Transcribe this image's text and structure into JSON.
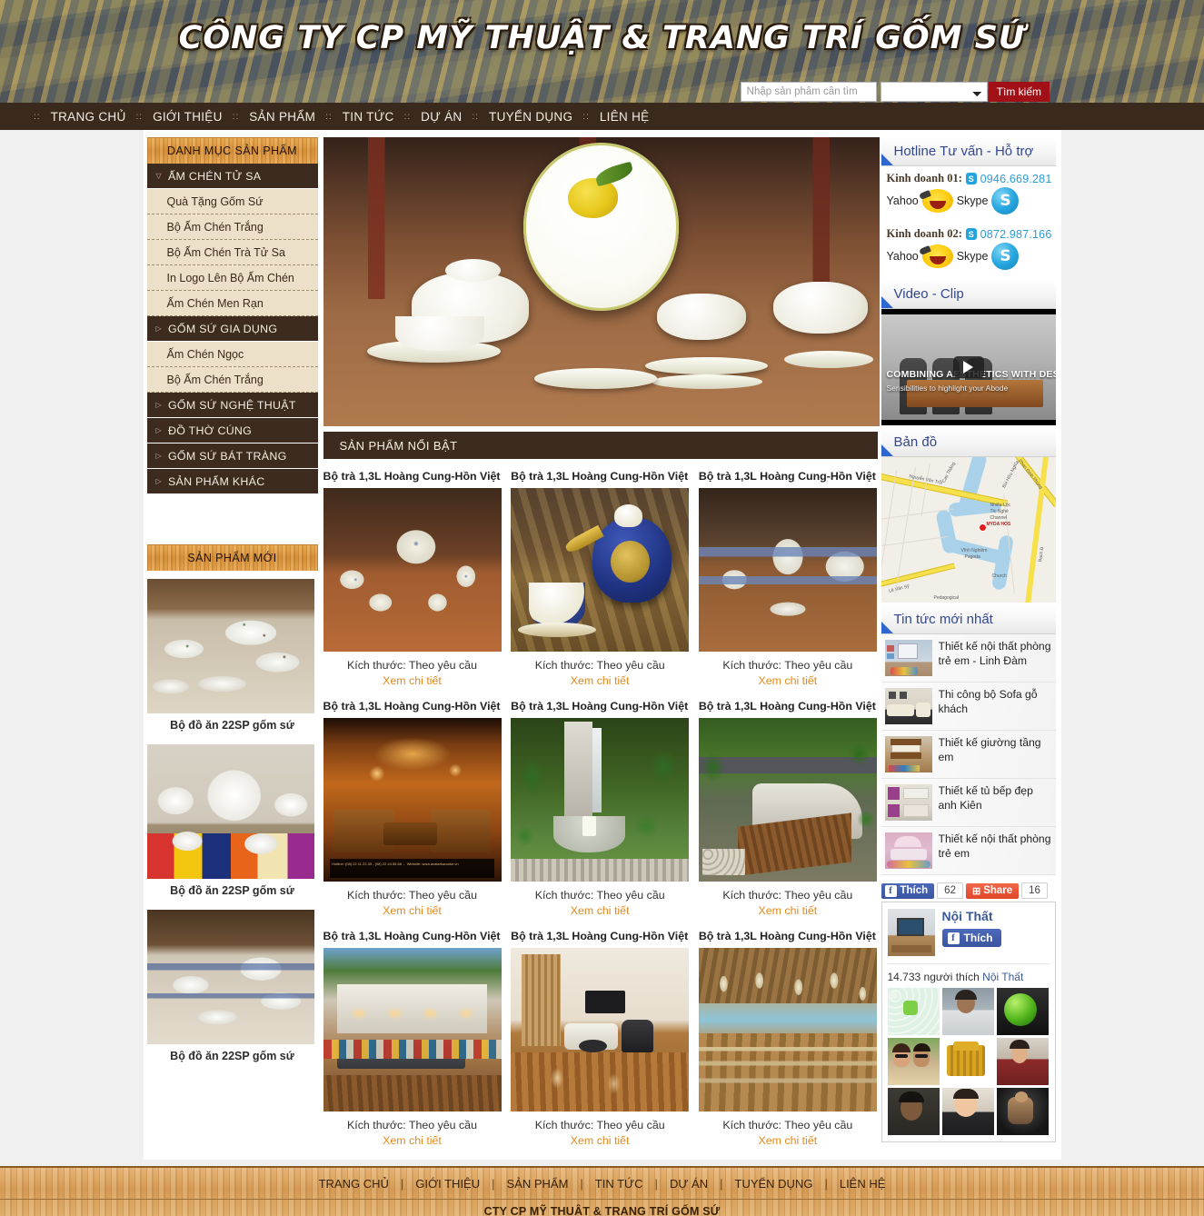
{
  "header": {
    "title": "CÔNG TY CP MỸ THUẬT & TRANG TRÍ GỐM SỨ",
    "search": {
      "placeholder": "Nhập sản phẩm cần tìm",
      "value": "",
      "category_value": "",
      "button_label": "Tìm kiếm"
    }
  },
  "nav": {
    "separator": "::",
    "items": [
      {
        "label": "Trang chủ"
      },
      {
        "label": "Giới thiệu"
      },
      {
        "label": "Sản phẩm"
      },
      {
        "label": "Tin tức"
      },
      {
        "label": "Dự án"
      },
      {
        "label": "Tuyển dụng"
      },
      {
        "label": "Liên hệ"
      }
    ]
  },
  "sidebar_left": {
    "category_panel_title": "DANH MỤC SẢN PHẨM",
    "categories": [
      {
        "label": "ẤM CHÉN TỬ SA",
        "type": "top",
        "expanded": true
      },
      {
        "label": "Quà Tặng Gốm Sứ",
        "type": "sub"
      },
      {
        "label": "Bộ Ấm Chén Trắng",
        "type": "sub"
      },
      {
        "label": "Bộ Ấm Chén Trà Tử Sa",
        "type": "sub"
      },
      {
        "label": "In Logo Lên Bộ Ấm Chén",
        "type": "sub"
      },
      {
        "label": "Ấm Chén Men Rạn",
        "type": "sub"
      },
      {
        "label": "GỐM SỨ GIA DỤNG",
        "type": "top",
        "expanded": false
      },
      {
        "label": "Ấm Chén Ngọc",
        "type": "sub"
      },
      {
        "label": "Bộ Ấm Chén Trắng",
        "type": "sub"
      },
      {
        "label": "GỐM SỨ NGHỆ THUẬT",
        "type": "top",
        "expanded": false
      },
      {
        "label": "ĐỒ THỜ CÚNG",
        "type": "top",
        "expanded": false
      },
      {
        "label": "GỐM SỨ BÁT TRÀNG",
        "type": "top",
        "expanded": false
      },
      {
        "label": "SẢN PHẨM KHÁC",
        "type": "top",
        "expanded": false
      }
    ],
    "new_products_title": "SẢN PHẨM MỚI",
    "new_products": [
      {
        "caption": "Bộ đồ ăn 22SP gốm sứ",
        "image": "bowls-green-rim"
      },
      {
        "caption": "Bộ đồ ăn 22SP gốm sứ",
        "image": "dinnerware-on-colorful-cloth"
      },
      {
        "caption": "Bộ đồ ăn 22SP gốm sứ",
        "image": "blue-rim-bowls-stack"
      }
    ]
  },
  "main": {
    "banner_image": "lemon-pattern-dinner-set",
    "featured_title": "SẢN PHẨM NỔI BẬT",
    "size_label": "Kích thước: Theo yêu cầu",
    "detail_link_label": "Xem chi tiết",
    "products": [
      {
        "title": "Bộ trà 1,3L Hoàng Cung-Hồn Việt",
        "image": "blue-white-tea-set"
      },
      {
        "title": "Bộ trà 1,3L Hoàng Cung-Hồn Việt",
        "image": "cobalt-gold-teapot"
      },
      {
        "title": "Bộ trà 1,3L Hoàng Cung-Hồn Việt",
        "image": "blue-band-bowls"
      },
      {
        "title": "Bộ trà 1,3L Hoàng Cung-Hồn Việt",
        "image": "karaoke-room-interior"
      },
      {
        "title": "Bộ trà 1,3L Hoàng Cung-Hồn Việt",
        "image": "garden-water-feature"
      },
      {
        "title": "Bộ trà 1,3L Hoàng Cung-Hồn Việt",
        "image": "courtyard-deck-garden"
      },
      {
        "title": "Bộ trà 1,3L Hoàng Cung-Hồn Việt",
        "image": "terrace-lounge-night"
      },
      {
        "title": "Bộ trà 1,3L Hoàng Cung-Hồn Việt",
        "image": "modern-living-room"
      },
      {
        "title": "Bộ trà 1,3L Hoàng Cung-Hồn Việt",
        "image": "beach-restaurant-hall"
      }
    ]
  },
  "sidebar_right": {
    "hotline_panel_title": "Hotline Tư vấn - Hỗ trợ",
    "contacts": [
      {
        "label": "Kinh doanh 01:",
        "phone": "0946.669.281",
        "yahoo_label": "Yahoo",
        "skype_label": "Skype"
      },
      {
        "label": "Kinh doanh 02:",
        "phone": "0872.987.166",
        "yahoo_label": "Yahoo",
        "skype_label": "Skype"
      }
    ],
    "video_panel_title": "Video - Clip",
    "video": {
      "headline": "COMBINING AESTHETICS WITH DESIGN",
      "subline": "Sensibilities to highlight your Abode"
    },
    "map_panel_title": "Bản đồ",
    "map": {
      "marker_label": "MYDA HOS",
      "roads": [
        "Nguyễn Văn Trỗi",
        "Cao Thắng",
        "Bùi Hữu Nghĩa",
        "Phan Đình Phùng",
        "Lê Văn Sỹ",
        "Hùng Vương",
        "Bạch Đằng"
      ],
      "places": [
        "Nhiêu Lộc - Thị Nghè Channel",
        "Vĩnh Nghiêm Pagoda",
        "Church",
        "Pedagogical"
      ]
    },
    "news_panel_title": "Tin tức mới nhất",
    "news": [
      {
        "title": "Thiết kế nội thất phòng trẻ em - Linh Đàm",
        "image": "kids-room-blue"
      },
      {
        "title": "Thi công bộ Sofa gỗ khách",
        "image": "living-room-sofa"
      },
      {
        "title": "Thiết kế giường tầng em",
        "image": "bunk-bed-wood"
      },
      {
        "title": "Thiết kế tủ bếp đẹp anh Kiên",
        "image": "purple-kitchen"
      },
      {
        "title": "Thiết kế nội thất phòng trẻ em",
        "image": "pink-kids-bedroom"
      }
    ],
    "facebook": {
      "like_label": "Thích",
      "like_count": "62",
      "share_label": "Share",
      "share_count": "16",
      "page_name": "Nội Thất",
      "page_like_label": "Thích",
      "likes_text_prefix": "14.733 người thích",
      "likes_text_page": "Nội Thất",
      "faces": [
        "emoji-pattern",
        "man-portrait",
        "green-vase",
        "couple-sunglasses",
        "gold-altar-furniture",
        "woman-at-counter",
        "man-smiling",
        "baby-portrait",
        "bodybuilder"
      ]
    }
  },
  "footer": {
    "items": [
      {
        "label": "Trang chủ"
      },
      {
        "label": "Giới thiệu"
      },
      {
        "label": "Sản phẩm"
      },
      {
        "label": "Tin tức"
      },
      {
        "label": "Dự án"
      },
      {
        "label": "Tuyển dụng"
      },
      {
        "label": "Liên hệ"
      }
    ],
    "separator": "|",
    "company": "CTY CP MỸ THUẬT & TRANG TRÍ GỐM SỨ"
  },
  "colors": {
    "nav_bar": "#3a2a1d",
    "wood_accent": "#d48f38",
    "link_orange": "#e08a1e",
    "panel_title_blue": "#33478c",
    "search_button_red": "#a11016",
    "submenu_cream": "#ece0c9"
  }
}
